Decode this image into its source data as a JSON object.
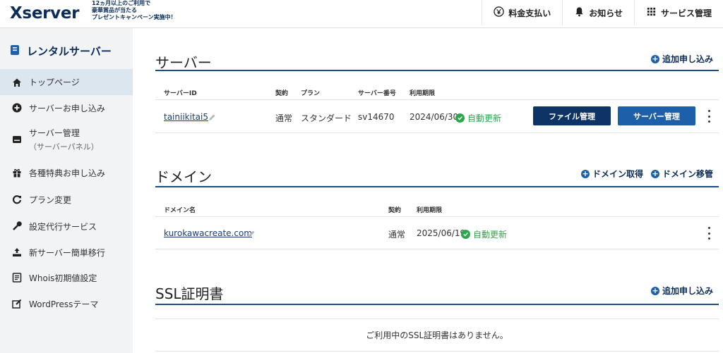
{
  "header": {
    "logo": "Xserver",
    "promo": [
      "12ヵ月以上のご利用で",
      "豪華賞品が当たる",
      "プレゼントキャンペーン実施中！"
    ],
    "actions": [
      {
        "label": "料金支払い",
        "icon": "yen-icon"
      },
      {
        "label": "お知らせ",
        "icon": "bell-icon"
      },
      {
        "label": "サービス管理",
        "icon": "grid-icon"
      }
    ]
  },
  "sidebar": {
    "title": "レンタルサーバー",
    "items": [
      {
        "label": "トップページ",
        "icon": "home-icon",
        "active": true
      },
      {
        "label": "サーバーお申し込み",
        "icon": "plus-circle-icon"
      },
      {
        "label": "サーバー管理",
        "sub": "（サーバーパネル）",
        "icon": "server-icon"
      },
      {
        "label": "各種特典お申し込み",
        "icon": "gift-icon"
      },
      {
        "label": "プラン変更",
        "icon": "refresh-icon"
      },
      {
        "label": "設定代行サービス",
        "icon": "wrench-icon"
      },
      {
        "label": "新サーバー簡単移行",
        "icon": "transfer-icon"
      },
      {
        "label": "Whois初期値設定",
        "icon": "document-icon"
      },
      {
        "label": "WordPressテーマ",
        "icon": "edit-icon"
      }
    ]
  },
  "server": {
    "title": "サーバー",
    "add_link": "追加申し込み",
    "columns": [
      "サーバーID",
      "契約",
      "プラン",
      "サーバー番号",
      "利用期限"
    ],
    "row": {
      "id": "tainiikitai5",
      "contract": "通常",
      "plan": "スタンダード",
      "number": "sv14670",
      "expiry": "2024/06/30",
      "renew": "自動更新",
      "file_btn": "ファイル管理",
      "server_btn": "サーバー管理"
    }
  },
  "domain": {
    "title": "ドメイン",
    "get_link": "ドメイン取得",
    "move_link": "ドメイン移管",
    "columns": [
      "ドメイン名",
      "契約",
      "利用期限"
    ],
    "row": {
      "name": "kurokawacreate.com",
      "contract": "通常",
      "expiry": "2025/06/19",
      "renew": "自動更新"
    }
  },
  "ssl": {
    "title": "SSL証明書",
    "add_link": "追加申し込み",
    "empty": "ご利用中のSSL証明書はありません。"
  },
  "colors": {
    "brand": "#0c2d57",
    "accent": "#1d5fa8",
    "active_bg": "#dce6ef",
    "renew_green": "#2aa84a"
  }
}
